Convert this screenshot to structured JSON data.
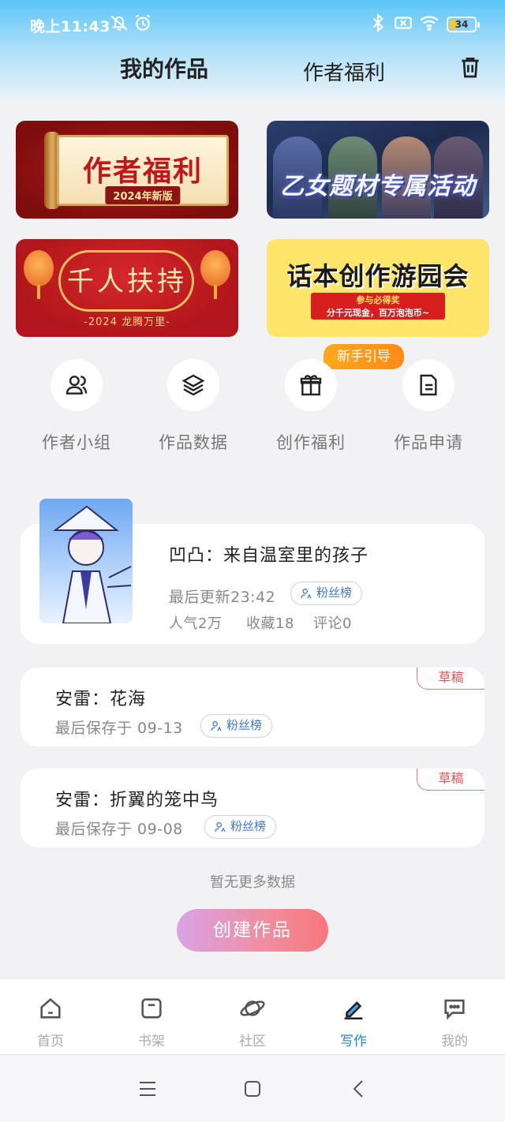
{
  "status_bar": {
    "time": "晚上11:43",
    "battery": "34",
    "battery_percent": 34
  },
  "header": {
    "tab_works": "我的作品",
    "tab_benefits": "作者福利"
  },
  "banners": [
    {
      "title": "作者福利",
      "subtitle": "2024年新版"
    },
    {
      "title": "乙女题材专属活动"
    },
    {
      "title": "千人扶持",
      "subtitle": "-2024 龙腾万里-"
    },
    {
      "title": "话本创作游园会",
      "line1": "参与必得奖",
      "line2": "分千元现金，百万泡泡币~"
    }
  ],
  "guide_badge": "新手引导",
  "quick_actions": [
    {
      "label": "作者小组",
      "icon": "users-icon"
    },
    {
      "label": "作品数据",
      "icon": "layers-icon"
    },
    {
      "label": "创作福利",
      "icon": "gift-icon"
    },
    {
      "label": "作品申请",
      "icon": "document-icon"
    }
  ],
  "works": [
    {
      "title": "凹凸：来自温室里的孩子",
      "updated": "最后更新23:42",
      "badge": "粉丝榜",
      "popularity": "人气2万",
      "favorites": "收藏18",
      "comments": "评论0"
    },
    {
      "title": "安雷：花海",
      "saved": "最后保存于 09-13",
      "badge": "粉丝榜",
      "status": "草稿"
    },
    {
      "title": "安雷：折翼的笼中鸟",
      "saved": "最后保存于 09-08",
      "badge": "粉丝榜",
      "status": "草稿"
    }
  ],
  "no_more": "暂无更多数据",
  "create_button": "创建作品",
  "bottom_nav": [
    {
      "label": "首页",
      "icon": "home-icon"
    },
    {
      "label": "书架",
      "icon": "bookshelf-icon"
    },
    {
      "label": "社区",
      "icon": "planet-icon"
    },
    {
      "label": "写作",
      "icon": "pen-icon",
      "active": true
    },
    {
      "label": "我的",
      "icon": "chat-icon"
    }
  ],
  "colors": {
    "accent": "#1a86e8",
    "draft": "#e55454",
    "guide": "#ff9a1a"
  }
}
